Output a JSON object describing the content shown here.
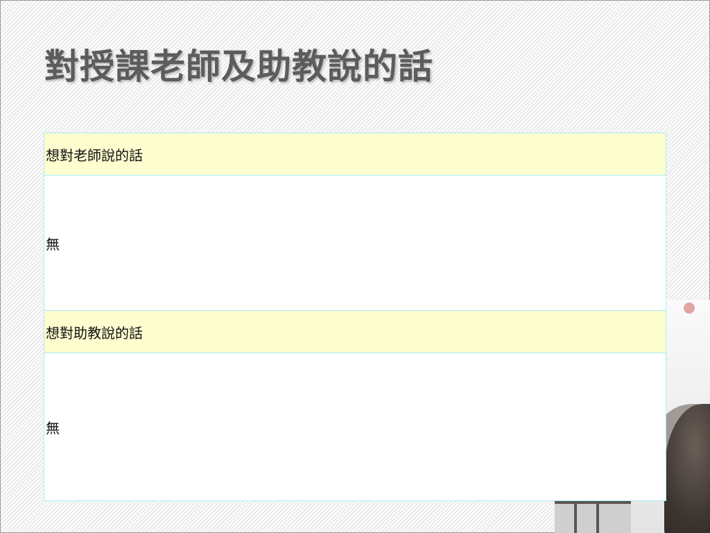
{
  "slide": {
    "title": "對授課老師及助教說的話"
  },
  "table": {
    "rows": [
      {
        "header": "想對老師說的話",
        "content": "無"
      },
      {
        "header": "想對助教說的話",
        "content": "無"
      }
    ]
  },
  "colors": {
    "header_fill": "#fdfdd0",
    "cell_border": "#a9eef2",
    "title_text": "#5c5c5c"
  }
}
